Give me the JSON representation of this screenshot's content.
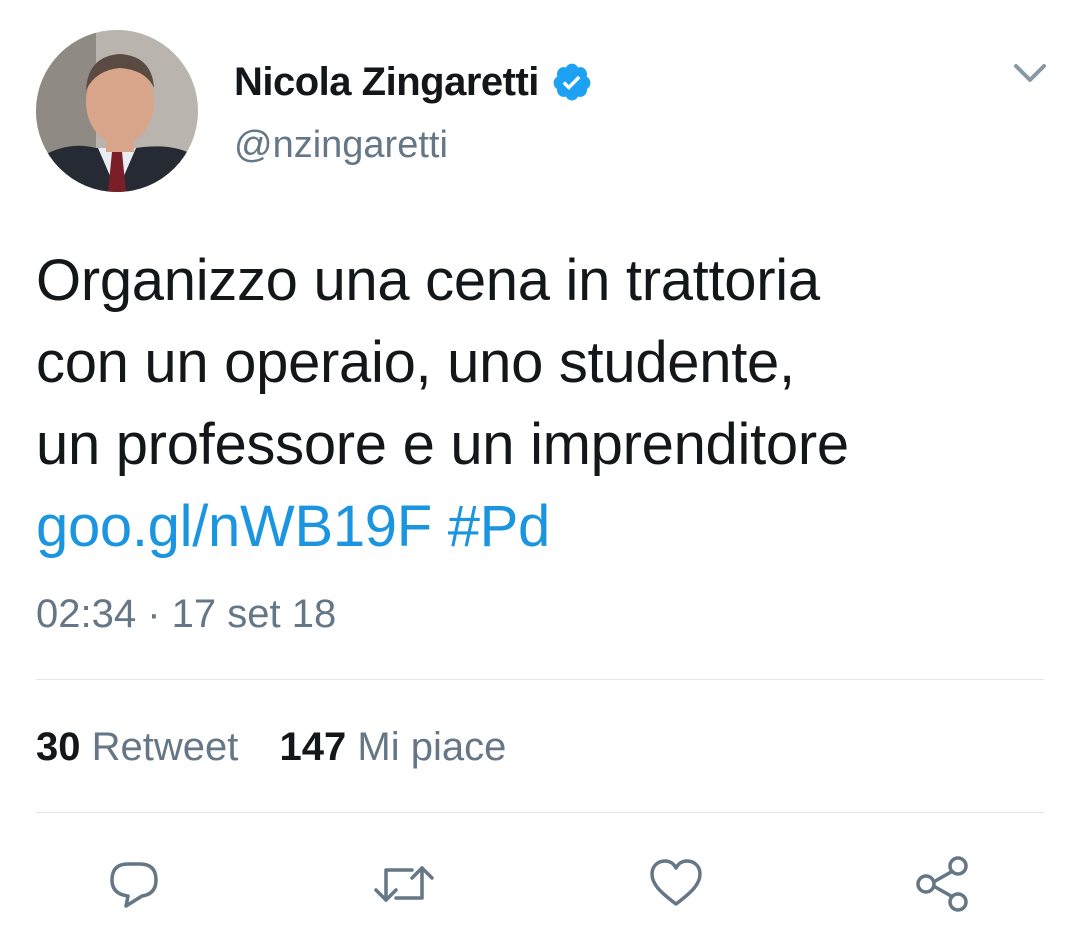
{
  "author": {
    "name": "Nicola Zingaretti",
    "handle": "@nzingaretti",
    "verified_icon": "verified-badge-icon",
    "avatar_icon": "avatar-photo"
  },
  "menu": {
    "icon": "chevron-down-icon"
  },
  "tweet": {
    "lines": [
      "Organizzo una cena in trattoria",
      "con un operaio, uno studente,",
      "un professore e un imprenditore"
    ],
    "link_text": "goo.gl/nWB19F",
    "hashtag": "#Pd",
    "timestamp": "02:34 · 17 set 18"
  },
  "stats": {
    "retweets_count": "30",
    "retweets_label": "Retweet",
    "likes_count": "147",
    "likes_label": "Mi piace"
  },
  "actions": {
    "reply_icon": "reply-icon",
    "retweet_icon": "retweet-icon",
    "like_icon": "heart-icon",
    "share_icon": "share-icon"
  },
  "colors": {
    "link": "#1b95e0",
    "secondary_text": "#657786",
    "primary_text": "#14171a",
    "verified": "#1da1f2",
    "divider": "#e1e8ed"
  }
}
